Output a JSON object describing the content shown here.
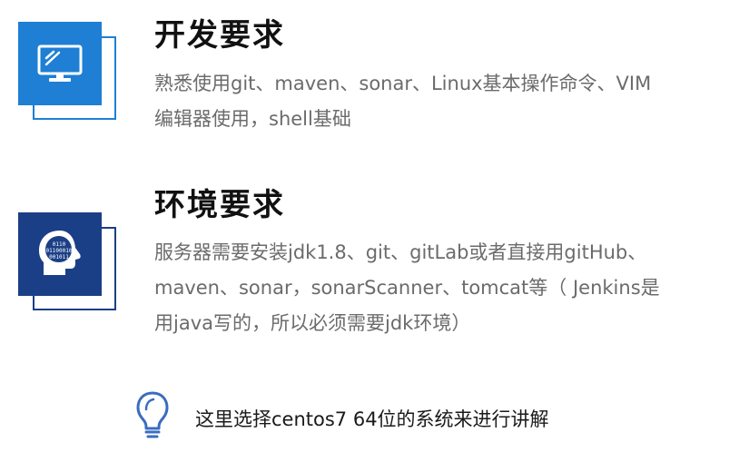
{
  "dev_requirements": {
    "title": "开发要求",
    "lines": [
      "熟悉使用git、maven、sonar、Linux基本操作命令、VIM",
      "编辑器使用，shell基础"
    ],
    "icon": "monitor-icon",
    "accent": "#1e7fd4"
  },
  "env_requirements": {
    "title": "环境要求",
    "lines": [
      "服务器需要安装jdk1.8、git、gitLab或者直接用gitHub、",
      "maven、sonar，sonarScanner、tomcat等（ Jenkins是",
      "用java写的，所以必须需要jdk环境）"
    ],
    "icon": "head-binary-icon",
    "head_digits": [
      "0110",
      "01100010",
      "001011"
    ],
    "accent": "#1b3f86"
  },
  "tip": {
    "icon": "lightbulb-icon",
    "text": "这里选择centos7 64位的系统来进行讲解",
    "accent": "#3a6cc0"
  }
}
